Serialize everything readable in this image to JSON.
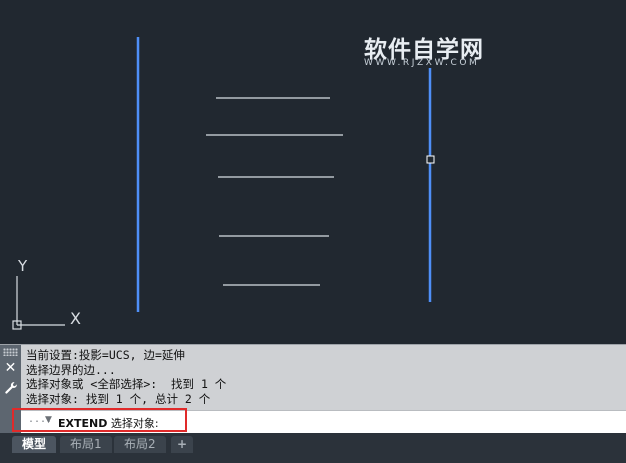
{
  "watermark": {
    "title": "软件自学网",
    "url": "WWW.RJZXW.COM"
  },
  "ucs": {
    "x_label": "X",
    "y_label": "Y"
  },
  "colors": {
    "background": "#212830",
    "selected_line": "#4f8ff7",
    "line": "#d8dde2",
    "highlight": "#e02a2a"
  },
  "command_history": [
    "当前设置:投影=UCS, 边=延伸",
    "选择边界的边...",
    "选择对象或 <全部选择>:  找到 1 个",
    "选择对象: 找到 1 个, 总计 2 个"
  ],
  "command_line": {
    "command": "EXTEND",
    "prompt": "选择对象:",
    "value": ""
  },
  "sidebar": {
    "close_icon": "close-icon",
    "customize_icon": "wrench-icon"
  },
  "tabs": [
    {
      "label": "模型",
      "active": true
    },
    {
      "label": "布局1",
      "active": false
    },
    {
      "label": "布局2",
      "active": false
    },
    {
      "label": "+",
      "active": false
    }
  ]
}
